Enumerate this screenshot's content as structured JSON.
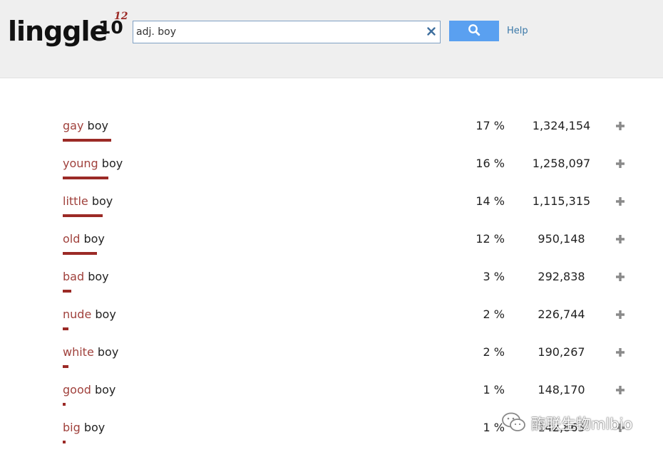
{
  "header": {
    "logo_main": "linggle",
    "logo_number": "10",
    "logo_superscript": "12",
    "search_value": "adj. boy",
    "help_label": "Help",
    "search_icon": "search-icon",
    "clear_icon": "close-icon"
  },
  "colors": {
    "adjective": "#a0413c",
    "bar": "#9b2a26",
    "search_button": "#5aa0f0",
    "link": "#3a78a8"
  },
  "results": [
    {
      "adj": "gay",
      "noun": "boy",
      "percent": "17 %",
      "share": 0.17,
      "count": "1,324,154"
    },
    {
      "adj": "young",
      "noun": "boy",
      "percent": "16 %",
      "share": 0.16,
      "count": "1,258,097"
    },
    {
      "adj": "little",
      "noun": "boy",
      "percent": "14 %",
      "share": 0.14,
      "count": "1,115,315"
    },
    {
      "adj": "old",
      "noun": "boy",
      "percent": "12 %",
      "share": 0.12,
      "count": "950,148"
    },
    {
      "adj": "bad",
      "noun": "boy",
      "percent": "3 %",
      "share": 0.03,
      "count": "292,838"
    },
    {
      "adj": "nude",
      "noun": "boy",
      "percent": "2 %",
      "share": 0.02,
      "count": "226,744"
    },
    {
      "adj": "white",
      "noun": "boy",
      "percent": "2 %",
      "share": 0.02,
      "count": "190,267"
    },
    {
      "adj": "good",
      "noun": "boy",
      "percent": "1 %",
      "share": 0.01,
      "count": "148,170"
    },
    {
      "adj": "big",
      "noun": "boy",
      "percent": "1 %",
      "share": 0.01,
      "count": "142,863"
    }
  ],
  "watermark": {
    "text": "酶联生物mlbio",
    "icon": "wechat-icon"
  }
}
